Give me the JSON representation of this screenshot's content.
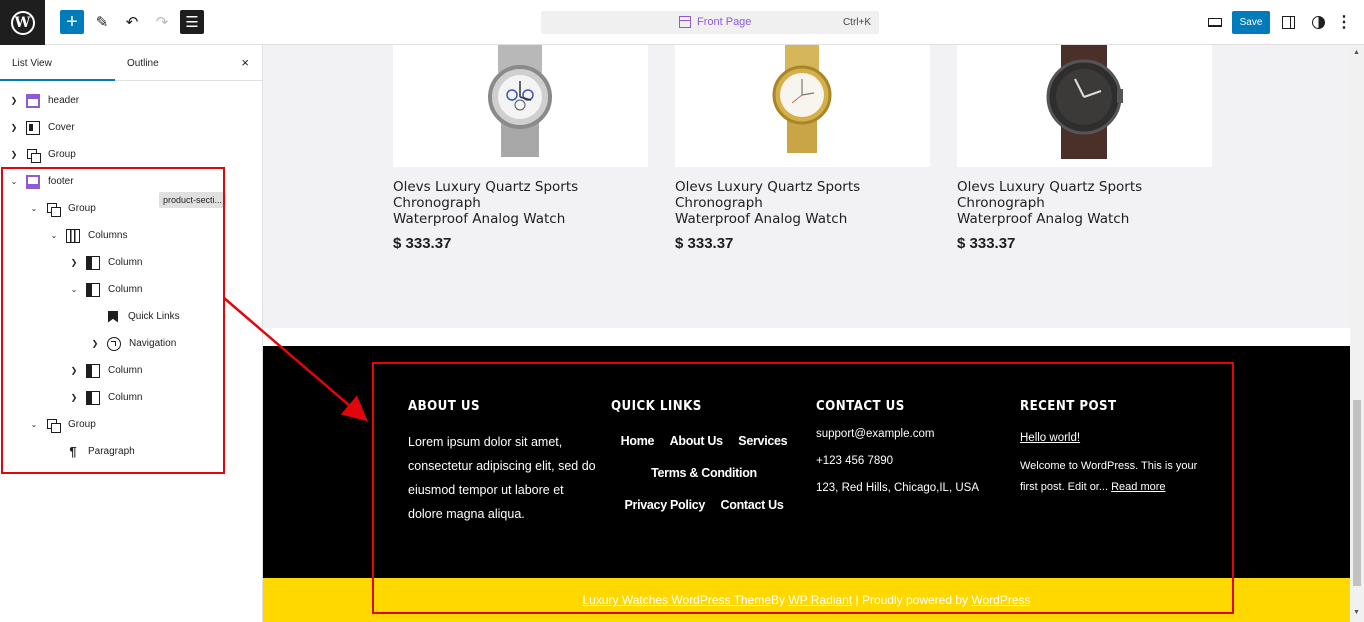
{
  "toolbar": {
    "logo_glyph": "W",
    "add_glyph": "+",
    "pencil_glyph": "✎",
    "undo_glyph": "↶",
    "redo_glyph": "↷",
    "listview_glyph": "☰",
    "more_glyph": "⋮",
    "save_label": "Save"
  },
  "command_center": {
    "title": "Front Page",
    "shortcut": "Ctrl+K"
  },
  "sidebar": {
    "tabs": [
      "List View",
      "Outline"
    ],
    "close_glyph": "×",
    "tree": [
      {
        "label": "header",
        "icon": "template-part-header-icon",
        "expanded": false
      },
      {
        "label": "Cover",
        "icon": "cover-icon",
        "expanded": false
      },
      {
        "label": "Group",
        "icon": "group-icon",
        "expanded": false,
        "badge": "product-secti..."
      },
      {
        "label": "footer",
        "icon": "template-part-footer-icon",
        "expanded": true
      },
      {
        "label": "Group",
        "icon": "group-icon",
        "expanded": true
      },
      {
        "label": "Columns",
        "icon": "columns-icon",
        "expanded": true
      },
      {
        "label": "Column",
        "icon": "column-icon",
        "expanded": false
      },
      {
        "label": "Column",
        "icon": "column-icon",
        "expanded": true
      },
      {
        "label": "Quick Links",
        "icon": "bookmark-icon"
      },
      {
        "label": "Navigation",
        "icon": "navigation-icon",
        "expanded": false
      },
      {
        "label": "Column",
        "icon": "column-icon",
        "expanded": false
      },
      {
        "label": "Column",
        "icon": "column-icon",
        "expanded": false
      },
      {
        "label": "Group",
        "icon": "group-icon",
        "expanded": true
      },
      {
        "label": "Paragraph",
        "icon": "paragraph-icon"
      }
    ]
  },
  "products": [
    {
      "name_lines": [
        "Olevs Luxury Quartz Sports",
        "Chronograph",
        "Waterproof Analog Watch"
      ],
      "price": "$ 333.37"
    },
    {
      "name_lines": [
        "Olevs Luxury Quartz Sports",
        "Chronograph",
        "Waterproof Analog Watch"
      ],
      "price": "$ 333.37"
    },
    {
      "name_lines": [
        "Olevs Luxury Quartz Sports",
        "Chronograph",
        "Waterproof Analog Watch"
      ],
      "price": "$ 333.37"
    }
  ],
  "footer": {
    "about": {
      "heading": "ABOUT US",
      "text": "Lorem ipsum dolor sit amet, consectetur adipiscing elit, sed do eiusmod tempor ut labore et dolore magna aliqua."
    },
    "quick_links": {
      "heading": "QUICK LINKS",
      "links": [
        "Home",
        "About Us",
        "Services",
        "Terms & Condition",
        "Privacy Policy",
        "Contact Us"
      ]
    },
    "contact": {
      "heading": "CONTACT US",
      "email": "support@example.com",
      "phone": "+123 456 7890",
      "address": "123, Red Hills, Chicago,IL, USA"
    },
    "recent": {
      "heading": "RECENT POST",
      "post_title": "Hello world!",
      "excerpt": "Welcome to WordPress. This is your first post. Edit or...",
      "read_more": "Read more"
    },
    "credit": {
      "theme_link": "Luxury Watches WordPress Theme",
      "by": "By",
      "author_link": "WP Radiant",
      "powered": " | Proudly powered by ",
      "wp_link": "WordPress"
    }
  },
  "colors": {
    "accent": "#007cba",
    "template_part": "#8e5bd4",
    "highlight": "#e0060c",
    "footer_bg": "#000000",
    "credit_bar": "#ffd800"
  }
}
